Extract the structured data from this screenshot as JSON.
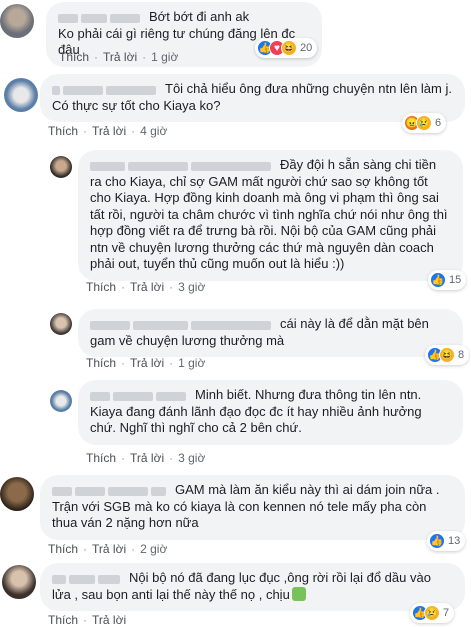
{
  "actions": {
    "like": "Thích",
    "reply": "Trả lời",
    "dot": "·"
  },
  "comments": [
    {
      "text": "Bớt bớt đi anh ak\nKo phải cái gì riêng tư chúng đăng lên đc đâu",
      "time": "1 giờ",
      "reaction_count": "20",
      "reactions": [
        "like-icon",
        "love-icon",
        "haha-icon"
      ]
    },
    {
      "text": "Tôi chả hiểu ông đưa những chuyện ntn lên làm j. Có thực sự tốt cho Kiaya ko?",
      "time": "4 giờ",
      "reaction_count": "6",
      "reactions": [
        "angry-icon",
        "sad-icon"
      ]
    },
    {
      "text": "Đầy đội h sẵn sàng chi tiền ra cho Kiaya, chỉ sợ GAM mất người chứ sao sợ không tốt cho Kiaya. Hợp đồng kinh doanh mà ông vi phạm thì ông sai tất rồi, người ta châm chước vì tình nghĩa chứ nói như ông thì hợp đồng viết ra để trưng bà rồi. Nội bộ của GAM cũng phải ntn về chuyện lương thưởng các thứ mà nguyên dàn coach phải out, tuyển thủ cũng muốn out là hiểu :))",
      "time": "3 giờ",
      "reaction_count": "15",
      "reactions": [
        "like-icon"
      ]
    },
    {
      "text": "cái này là để dằn mặt bên gam về chuyện lương thưởng mà",
      "time": "1 giờ",
      "reaction_count": "8",
      "reactions": [
        "like-icon",
        "haha-icon"
      ]
    },
    {
      "text": "Minh biết. Nhưng đưa thông tin lên ntn. Kiaya đang đánh lãnh đạo đọc đc ít hay nhiều ảnh hưởng chứ. Nghĩ thì nghĩ cho cả 2 bên chứ.",
      "time": "3 giờ",
      "reaction_count": "",
      "reactions": []
    },
    {
      "text": "GAM mà làm ăn kiểu này thì ai dám join nữa . Trận với SGB mà ko có kiaya là con kennen nó tele mấy pha còn thua ván 2 nặng hơn nữa",
      "time": "2 giờ",
      "reaction_count": "13",
      "reactions": [
        "like-icon"
      ]
    },
    {
      "text": "Nội bộ nó đã đang lục đục ,ông rời rồi lại đổ dầu vào lửa , sau bọn anti lại thế này thế nọ , chịu",
      "time": "",
      "reaction_count": "7",
      "reactions": [
        "like-icon",
        "sad-icon"
      ]
    }
  ],
  "colors": {
    "bubble": "#f2f3f5",
    "link": "#4b4f56",
    "like": "#1877f2"
  }
}
